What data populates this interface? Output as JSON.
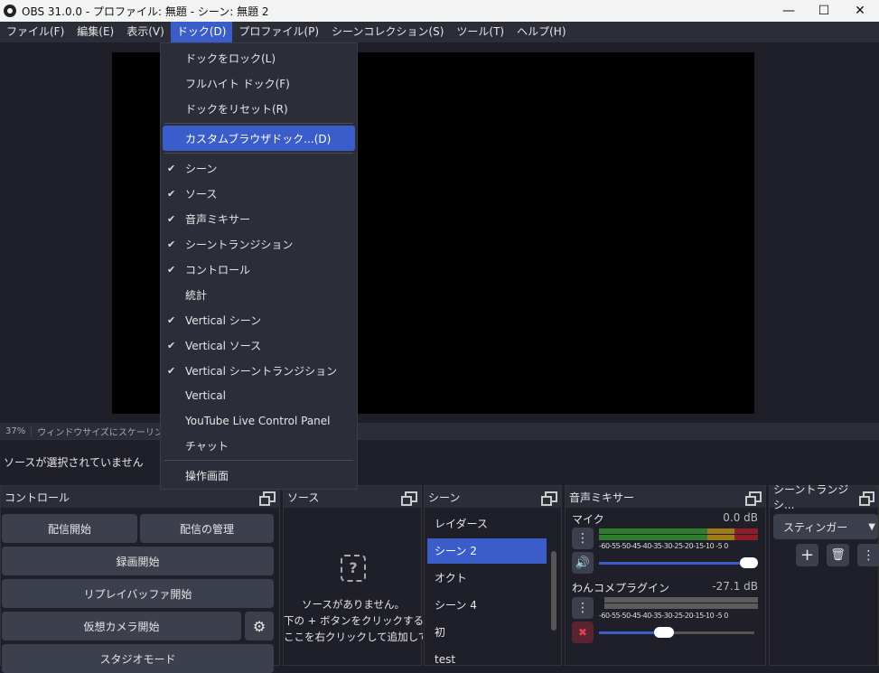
{
  "window": {
    "title": "OBS 31.0.0 - プロファイル: 無題 - シーン: 無題 2"
  },
  "menubar": [
    {
      "label": "ファイル(F)"
    },
    {
      "label": "編集(E)"
    },
    {
      "label": "表示(V)"
    },
    {
      "label": "ドック(D)"
    },
    {
      "label": "プロファイル(P)"
    },
    {
      "label": "シーンコレクション(S)"
    },
    {
      "label": "ツール(T)"
    },
    {
      "label": "ヘルプ(H)"
    }
  ],
  "dock_menu": {
    "top_items": [
      {
        "label": "ドックをロック(L)"
      },
      {
        "label": "フルハイト ドック(F)"
      },
      {
        "label": "ドックをリセット(R)"
      }
    ],
    "custom": {
      "label": "カスタムブラウザドック...(D)"
    },
    "docks": [
      {
        "label": "シーン",
        "checked": true
      },
      {
        "label": "ソース",
        "checked": true
      },
      {
        "label": "音声ミキサー",
        "checked": true
      },
      {
        "label": "シーントランジション",
        "checked": true
      },
      {
        "label": "コントロール",
        "checked": true
      },
      {
        "label": "統計",
        "checked": false
      },
      {
        "label": "Vertical シーン",
        "checked": true
      },
      {
        "label": "Vertical ソース",
        "checked": true
      },
      {
        "label": "Vertical シーントランジション",
        "checked": true
      },
      {
        "label": "Vertical",
        "checked": false
      },
      {
        "label": "YouTube Live Control Panel",
        "checked": false
      },
      {
        "label": "チャット",
        "checked": false
      }
    ],
    "bottom": {
      "label": "操作画面"
    },
    "check_mark": "✔"
  },
  "status": {
    "zoom": "37%",
    "scaling": "ウィンドウサイズにスケーリング表示"
  },
  "no_source": "ソースが選択されていません",
  "controls": {
    "title": "コントロール",
    "start_stream": "配信開始",
    "manage_stream": "配信の管理",
    "start_record": "録画開始",
    "replay_buffer": "リプレイバッファ開始",
    "virtual_cam": "仮想カメラ開始",
    "studio_mode": "スタジオモード"
  },
  "sources": {
    "title": "ソース",
    "empty_line1": "ソースがありません。",
    "empty_line2": "下の + ボタンをクリックするか",
    "empty_line3": "ここを右クリックして追加してく"
  },
  "scenes": {
    "title": "シーン",
    "items": [
      "レイダース",
      "シーン 2",
      "オクト",
      "シーン 4",
      "初",
      "test"
    ],
    "selected": "シーン 2"
  },
  "mixer": {
    "title": "音声ミキサー",
    "channels": [
      {
        "name": "マイク",
        "db": "0.0 dB",
        "volume": 1.0,
        "muted": false
      },
      {
        "name": "わんコメプラグイン",
        "db": "-27.1 dB",
        "volume": 0.45,
        "muted": true
      }
    ],
    "ticks": "-60-55-50-45-40-35-30-25-20-15-10 -5  0"
  },
  "transitions": {
    "title": "シーントランジシ...",
    "selected": "スティンガー"
  },
  "colors": {
    "accent": "#3b5dc9",
    "meter_green": "#2f7d2f",
    "meter_yellow": "#a07a17",
    "meter_red": "#8e1f28"
  }
}
